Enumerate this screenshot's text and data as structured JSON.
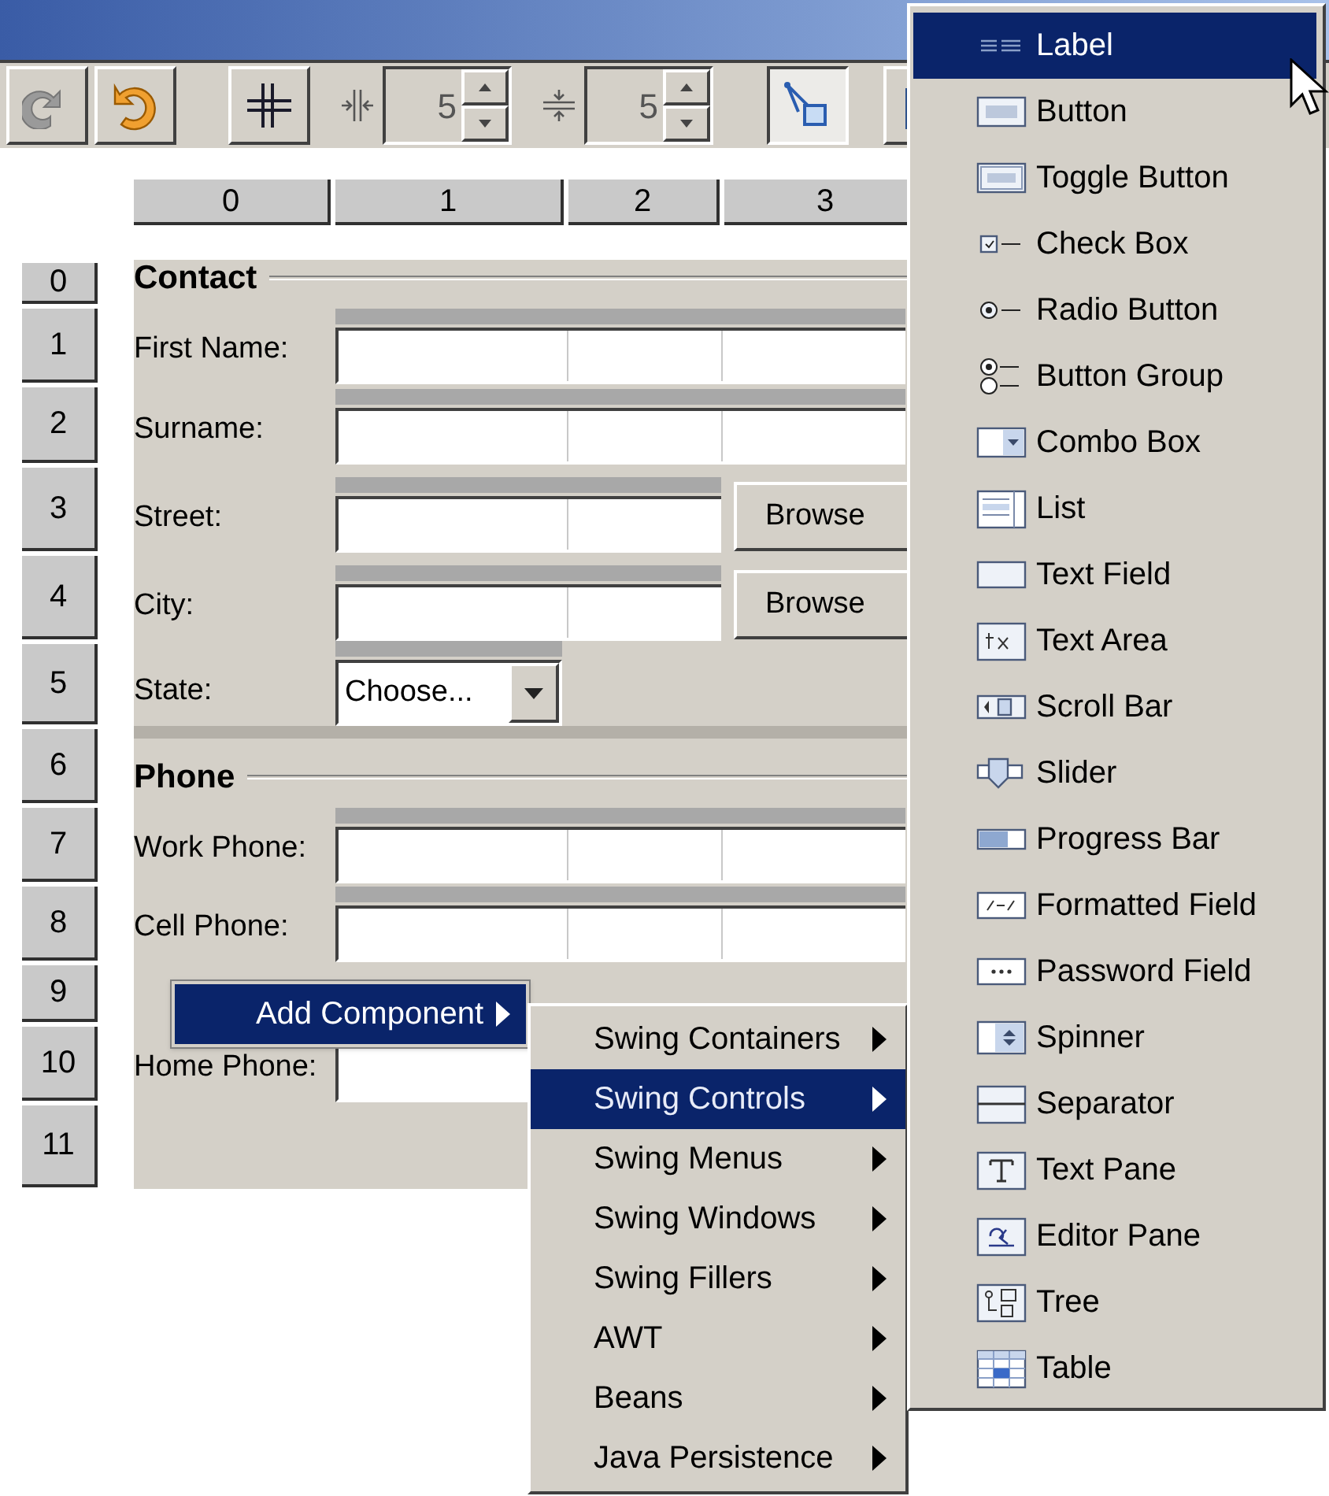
{
  "toolbar": {
    "left_buttons": [
      {
        "kind": "redo",
        "disabled": true
      },
      {
        "kind": "undo",
        "disabled": false
      },
      {
        "kind": "grid",
        "disabled": false
      }
    ],
    "gap_spinners": [
      {
        "kind": "horizontal",
        "value": "5"
      },
      {
        "kind": "vertical",
        "value": "5"
      }
    ],
    "right_buttons": [
      {
        "kind": "select",
        "pressed": true
      },
      {
        "kind": "preview",
        "pressed": false
      }
    ]
  },
  "columns": [
    "0",
    "1",
    "2",
    "3"
  ],
  "grid_rows": [
    {
      "number": "0",
      "kind": "heading",
      "text": "Contact"
    },
    {
      "number": "1",
      "kind": "field",
      "label": "First Name:"
    },
    {
      "number": "2",
      "kind": "field",
      "label": "Surname:"
    },
    {
      "number": "3",
      "kind": "browse",
      "label": "Street:",
      "button": "Browse"
    },
    {
      "number": "4",
      "kind": "browse",
      "label": "City:",
      "button": "Browse"
    },
    {
      "number": "5",
      "kind": "combo",
      "label": "State:",
      "value": "Choose..."
    },
    {
      "number": "6",
      "kind": "heading",
      "text": "Phone"
    },
    {
      "number": "7",
      "kind": "field",
      "label": "Work Phone:"
    },
    {
      "number": "8",
      "kind": "field",
      "label": "Cell Phone:"
    },
    {
      "number": "9",
      "kind": "empty"
    },
    {
      "number": "10",
      "kind": "field",
      "label": "Home Phone:"
    },
    {
      "number": "11",
      "kind": "empty"
    }
  ],
  "context_menu": {
    "items": [
      {
        "label": "Add Component",
        "selected": true
      }
    ]
  },
  "submenu": {
    "items": [
      {
        "label": "Swing Containers",
        "selected": false
      },
      {
        "label": "Swing Controls",
        "selected": true
      },
      {
        "label": "Swing Menus",
        "selected": false
      },
      {
        "label": "Swing Windows",
        "selected": false
      },
      {
        "label": "Swing Fillers",
        "selected": false
      },
      {
        "label": "AWT",
        "selected": false
      },
      {
        "label": "Beans",
        "selected": false
      },
      {
        "label": "Java Persistence",
        "selected": false
      }
    ]
  },
  "component_menu": {
    "items": [
      {
        "kind": "label",
        "label": "Label",
        "selected": true
      },
      {
        "kind": "button",
        "label": "Button",
        "selected": false
      },
      {
        "kind": "toggle",
        "label": "Toggle Button",
        "selected": false
      },
      {
        "kind": "checkbox",
        "label": "Check Box",
        "selected": false
      },
      {
        "kind": "radio",
        "label": "Radio Button",
        "selected": false
      },
      {
        "kind": "group",
        "label": "Button Group",
        "selected": false
      },
      {
        "kind": "combo",
        "label": "Combo Box",
        "selected": false
      },
      {
        "kind": "list",
        "label": "List",
        "selected": false
      },
      {
        "kind": "textfield",
        "label": "Text Field",
        "selected": false
      },
      {
        "kind": "textarea",
        "label": "Text Area",
        "selected": false
      },
      {
        "kind": "scrollbar",
        "label": "Scroll Bar",
        "selected": false
      },
      {
        "kind": "slider",
        "label": "Slider",
        "selected": false
      },
      {
        "kind": "progress",
        "label": "Progress Bar",
        "selected": false
      },
      {
        "kind": "formatted",
        "label": "Formatted Field",
        "selected": false
      },
      {
        "kind": "password",
        "label": "Password Field",
        "selected": false
      },
      {
        "kind": "spinner",
        "label": "Spinner",
        "selected": false
      },
      {
        "kind": "separator",
        "label": "Separator",
        "selected": false
      },
      {
        "kind": "textpane",
        "label": "Text Pane",
        "selected": false
      },
      {
        "kind": "editor",
        "label": "Editor Pane",
        "selected": false
      },
      {
        "kind": "tree",
        "label": "Tree",
        "selected": false
      },
      {
        "kind": "table",
        "label": "Table",
        "selected": false
      }
    ]
  }
}
